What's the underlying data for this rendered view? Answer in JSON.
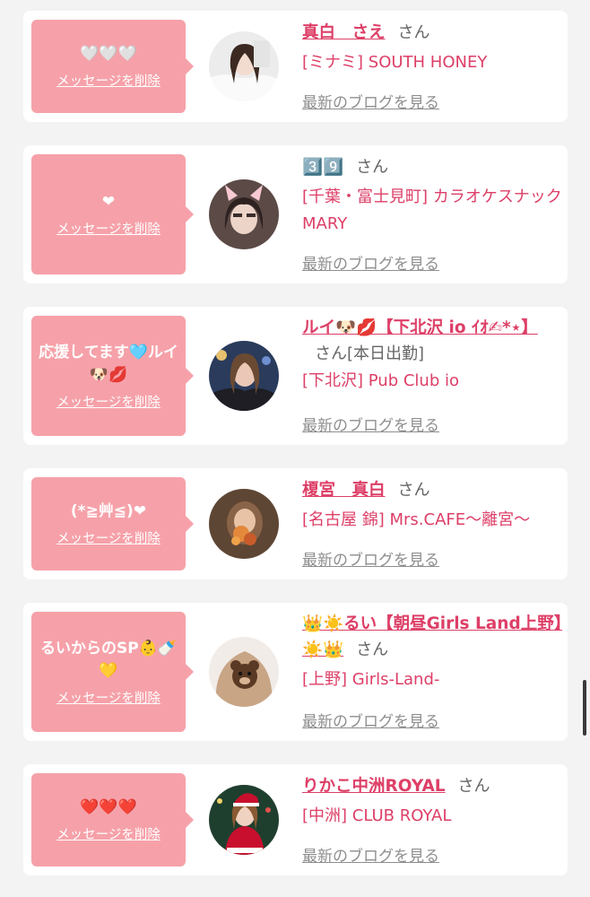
{
  "cards": [
    {
      "message": "🤍🤍🤍",
      "delete_label": "メッセージを削除",
      "name": "真白　さえ",
      "honorific": "さん",
      "extra": "",
      "shop": "[ミナミ] SOUTH HONEY",
      "blog_link": "最新のブログを見る"
    },
    {
      "message": "❤",
      "delete_label": "メッセージを削除",
      "name": "3️⃣9️⃣",
      "honorific": "さん",
      "extra": "",
      "shop": "[千葉・富士見町] カラオケスナック MARY",
      "blog_link": "最新のブログを見る"
    },
    {
      "message": "応援してます🩵ルイ🐶💋",
      "delete_label": "メッセージを削除",
      "name": "ルイ🐶💋【下北沢 io ｲｵ✍︎*⋆】",
      "honorific": "さん",
      "extra": "[本日出勤]",
      "shop": "[下北沢] Pub Club io",
      "blog_link": "最新のブログを見る"
    },
    {
      "message": "(*≧艸≦)❤",
      "delete_label": "メッセージを削除",
      "name": "榎宮　真白",
      "honorific": "さん",
      "extra": "",
      "shop": "[名古屋 錦] Mrs.CAFE〜離宮〜",
      "blog_link": "最新のブログを見る"
    },
    {
      "message": "るいからのSP👶🍼💛",
      "delete_label": "メッセージを削除",
      "name": "👑☀️るい【朝昼Girls Land上野】☀️👑",
      "honorific": "さん",
      "extra": "",
      "shop": "[上野] Girls-Land-",
      "blog_link": "最新のブログを見る"
    },
    {
      "message": "❤️❤️❤️",
      "delete_label": "メッセージを削除",
      "name": "りかこ中洲ROYAL",
      "honorific": "さん",
      "extra": "",
      "shop": "[中洲] CLUB ROYAL",
      "blog_link": "最新のブログを見る"
    }
  ],
  "colors": {
    "bubble": "#f6a1a9",
    "name": "#dd3f67",
    "shop": "#dd3f67",
    "link": "#8e8e8e",
    "page_bg": "#f4f3f4"
  }
}
